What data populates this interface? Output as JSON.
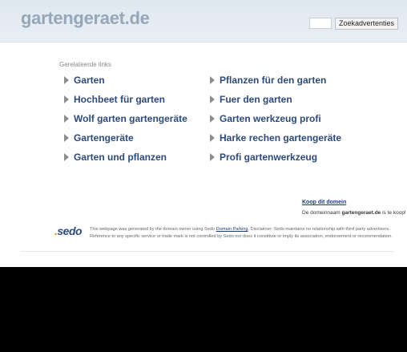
{
  "header": {
    "domain": "gartengeraet.de",
    "search_value": "",
    "search_button": "Zoekadvertenties"
  },
  "related": {
    "title": "Gerelateerde links",
    "left": [
      "Garten",
      "Hochbeet für garten",
      "Wolf garten gartengeräte",
      "Gartengeräte",
      "Garten und pflanzen"
    ],
    "right": [
      "Pflanzen für den garten",
      "Fuer den garten",
      "Garten werkzeug profi",
      "Harke rechen gartengeräte",
      "Profi gartenwerkzeug"
    ]
  },
  "buy": {
    "link": "Koop dit domein",
    "text_prefix": "De domeinnaam",
    "domain": "gartengeraet.de",
    "text_suffix": "is te koop!"
  },
  "footer": {
    "logo_text": "sedo",
    "disclaimer_before": "This webpage was generated by the domain owner using Sedo",
    "disclaimer_link": "Domain Parking",
    "disclaimer_after": ". Disclaimer: Sedo maintains no relationship with third party advertisers. Reference to any specific service or trade mark is not controlled by Sedo nor does it constitute or imply its association, endorsement or recommendation."
  }
}
